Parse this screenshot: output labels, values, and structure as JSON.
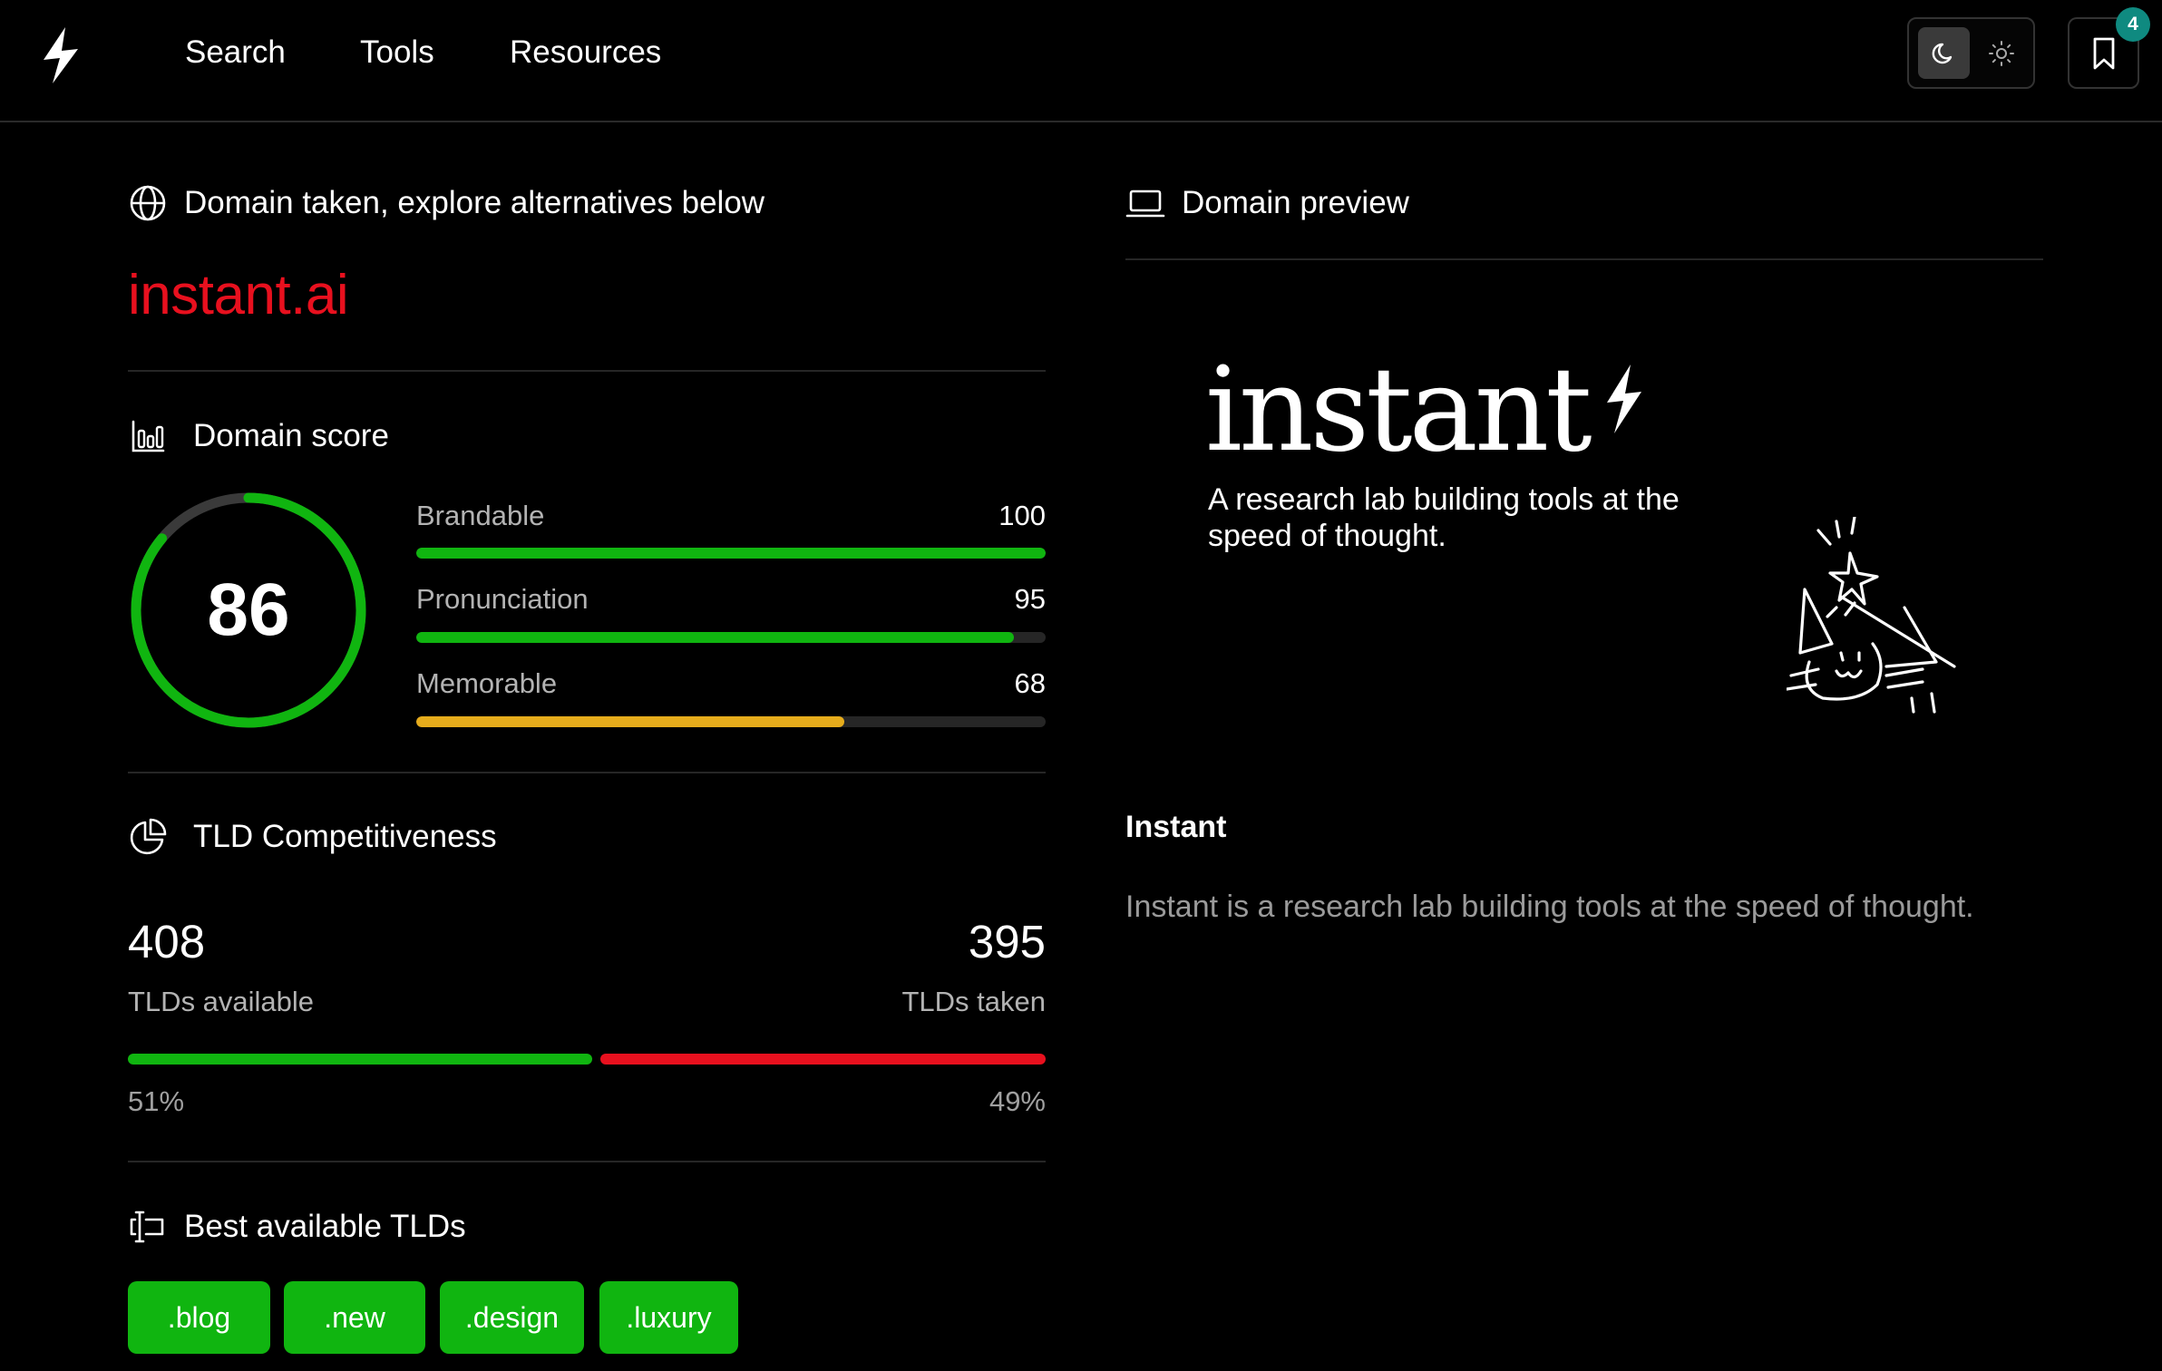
{
  "nav": {
    "items": [
      "Search",
      "Tools",
      "Resources"
    ],
    "bookmark_count": "4"
  },
  "left": {
    "status_text": "Domain taken, explore alternatives below",
    "domain": "instant.ai",
    "score_section": {
      "title": "Domain score",
      "overall": "86",
      "overall_value": 86,
      "metrics": [
        {
          "label": "Brandable",
          "value": "100",
          "fill": 1.0,
          "color": "#10b510"
        },
        {
          "label": "Pronunciation",
          "value": "95",
          "fill": 0.95,
          "color": "#10b510"
        },
        {
          "label": "Memorable",
          "value": "68",
          "fill": 0.68,
          "color": "#e6ac1c"
        }
      ]
    },
    "tld_section": {
      "title": "TLD Competitiveness",
      "available_count": "408",
      "available_label": "TLDs available",
      "taken_count": "395",
      "taken_label": "TLDs taken",
      "available_pct": "51%",
      "taken_pct": "49%",
      "available_fraction": 0.51,
      "available_color": "#10b510",
      "taken_color": "#e8101e"
    },
    "best_tlds": {
      "title": "Best available TLDs",
      "items": [
        ".blog",
        ".new",
        ".design",
        ".luxury"
      ]
    }
  },
  "right": {
    "title": "Domain preview",
    "preview": {
      "wordmark": "instant",
      "tagline": "A research lab building tools at the speed of thought."
    },
    "site_title": "Instant",
    "site_description": "Instant is a research lab building tools at the speed of thought."
  },
  "colors": {
    "accent_green": "#10b510",
    "taken_red": "#e8101e",
    "warning_yellow": "#e6ac1c",
    "badge_teal": "#0f8a80"
  },
  "icons": [
    "lightning-logo-icon",
    "moon-icon",
    "sun-icon",
    "bookmark-icon",
    "globe-icon",
    "bar-chart-icon",
    "pie-chart-icon",
    "text-cursor-icon",
    "laptop-icon"
  ]
}
